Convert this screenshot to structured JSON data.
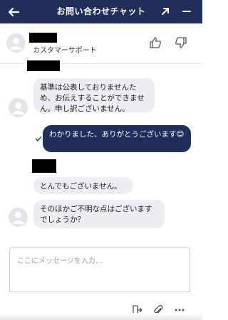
{
  "header": {
    "title": "お問い合わせチャット",
    "back_icon": "arrow-left-icon",
    "expand_icon": "expand-icon",
    "minimize_icon": "minimize-icon",
    "background": "#1f2f5a"
  },
  "agent": {
    "subtitle": "カスタマーサポート",
    "rate_up_icon": "thumbs-up-icon",
    "rate_down_icon": "thumbs-down-icon"
  },
  "messages": [
    {
      "from": "agent",
      "text": "基準は公表しておりませんため、お伝えすることができません。申し訳ございません。"
    },
    {
      "from": "user",
      "text": "わかりました、ありがとうございます😊",
      "status_icon": "check-icon"
    },
    {
      "from": "agent",
      "text": "とんでもございません。"
    },
    {
      "from": "agent",
      "text": "そのほかご不明な点はございますでしょうか？"
    }
  ],
  "composer": {
    "placeholder": "ここにメッセージを入力..."
  },
  "toolbar": {
    "icons": [
      "end-chat-icon",
      "attachment-icon",
      "more-icon"
    ]
  },
  "colors": {
    "accent": "#1f2f5a",
    "incoming_bubble": "#ebedf1"
  }
}
